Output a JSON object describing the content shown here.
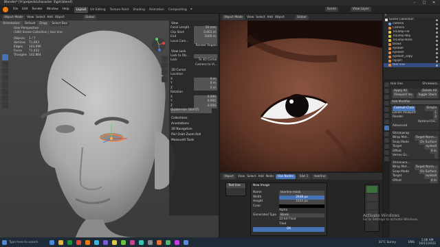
{
  "title_bar": {
    "title": "Blender* [A:\\projects\\character 3\\girl.blend]",
    "minimize": "–",
    "maximize": "□",
    "close": "✕"
  },
  "menu": [
    "File",
    "Edit",
    "Render",
    "Window",
    "Help"
  ],
  "workspaces": [
    "Layout",
    "UV Editing",
    "Texture Paint",
    "Shading",
    "Animation",
    "Compositing"
  ],
  "workspace_active": "Layout",
  "scene": {
    "label": "Scene",
    "view_layer": "View Layer"
  },
  "viewport": {
    "mode": "Object Mode",
    "menus": [
      "View",
      "Select",
      "Add",
      "Object"
    ],
    "orientation_label": "Orientation:",
    "orientation": "Default",
    "drag_label": "Drag:",
    "drag": "Select Box",
    "transform": "Global",
    "overlay": {
      "title": "User Perspective",
      "collection": "(180) Scene Collection | tear line",
      "stats": [
        {
          "k": "Objects",
          "v": "1 / 7"
        },
        {
          "k": "Vertices",
          "v": "71,663"
        },
        {
          "k": "Edges",
          "v": "143,096"
        },
        {
          "k": "Faces",
          "v": "71,433"
        },
        {
          "k": "Triangles",
          "v": "142,864"
        }
      ]
    }
  },
  "npanel": {
    "view_header": "View",
    "focal_length": {
      "label": "Focal Length",
      "value": "50 mm"
    },
    "clip_start": {
      "label": "Clip Start",
      "value": "0.001 m"
    },
    "clip_end": {
      "label": "End",
      "value": "1000 m"
    },
    "local_camera": "Local Cam...",
    "render_region": "Render Region",
    "view_lock": "View Lock",
    "lock_to_obj": "Lock to Ob...",
    "lock": "Lock",
    "to_3d_cursor": "To 3D Cursor",
    "camera_to_view": "Camera to Vi...",
    "cursor_header": "3D Cursor",
    "location": "Location",
    "loc": [
      {
        "k": "X",
        "v": "0 m"
      },
      {
        "k": "Y",
        "v": "0 m"
      },
      {
        "k": "Z",
        "v": "0 m"
      }
    ],
    "rotation": "Rotation",
    "rot": [
      {
        "k": "X",
        "v": "0.000"
      },
      {
        "k": "Y",
        "v": "0.000"
      },
      {
        "k": "Z",
        "v": "0.000"
      }
    ],
    "rotation_mode": "Quaternion (WXYZ)",
    "collections": "Collections",
    "annotations": "Annotations",
    "navigation": "3D Navigation",
    "pie": "Pie! Orbit Zoom Roll",
    "measureit": "MeasureIt Tools",
    "tabs": [
      "Item",
      "Tool",
      "View",
      "Edit",
      "Create"
    ]
  },
  "outliner": {
    "header": "Scene Collection",
    "rows": [
      {
        "name": "Scene Collection",
        "color": "#dddddd",
        "sel": false
      },
      {
        "name": "camera",
        "color": "#6699dd",
        "sel": false
      },
      {
        "name": "Camera",
        "color": "#e08a3c",
        "sel": false
      },
      {
        "name": "TriLamp-Fill",
        "color": "#e0c83c",
        "sel": false
      },
      {
        "name": "TriLamp-Key",
        "color": "#e0c83c",
        "sel": false
      },
      {
        "name": "TriLamp-Back",
        "color": "#e0c83c",
        "sel": false
      },
      {
        "name": "brows",
        "color": "#e08a3c",
        "sel": false
      },
      {
        "name": "eyeball",
        "color": "#e08a3c",
        "sel": false
      },
      {
        "name": "eyelash",
        "color": "#e08a3c",
        "sel": false
      },
      {
        "name": "eyelash_copy",
        "color": "#e08a3c",
        "sel": false
      },
      {
        "name": "rig.girl",
        "color": "#e08a3c",
        "sel": false
      },
      {
        "name": "tear line",
        "color": "#e08a3c",
        "sel": true
      }
    ]
  },
  "properties": {
    "object": "tear line",
    "modifier": "Shrinkwra...",
    "apply_all": "Apply All",
    "delete_all": "Delete All",
    "viewport_vis": "Viewport Vis",
    "toggle_stack": "Toggle Stack",
    "add_modifier": "Add Modifier",
    "subdiv_tabs": [
      "Catmull-Clark",
      "Simple"
    ],
    "levels_viewport": {
      "label": "Levels Viewport",
      "value": "1"
    },
    "render": {
      "label": "Render",
      "value": "2"
    },
    "optimal_display": "Optimal Dis...",
    "advanced": "Advanced",
    "mod1": "Shrinkwrap",
    "wrap_method_label": "Wrap Met...",
    "wrap_method_1": "Target Norm...",
    "snap_mode_label": "Snap Mode",
    "snap_mode_1": "On Surface",
    "target_label": "Target",
    "target_1": "eyeball",
    "offset_label": "Offset",
    "offset_1": "0 m",
    "vertex_group_label": "Vertex Gr...",
    "mod2": "Shrinkwra...",
    "wrap_method_2": "Target Norm...",
    "snap_mode_2": "On Surface",
    "target_2": "eyeball",
    "offset_2": "0 m"
  },
  "node_editor": {
    "type": "Object",
    "menus": [
      "View",
      "Select",
      "Add",
      "Node"
    ],
    "use_nodes": "Use Nodes",
    "slot": "Slot 1",
    "material": "tearline",
    "side_tabs": [
      "Node",
      "Tool",
      "View",
      "Options"
    ],
    "text_line_node": "Text line",
    "new_image_node": "New Image",
    "image": {
      "name": {
        "label": "Name",
        "value": "tearline mask"
      },
      "width": {
        "label": "Width",
        "value": "2048 px"
      },
      "height": {
        "label": "Height",
        "value": "1024 px"
      },
      "color": "Color",
      "alpha": "Alpha",
      "generated_type": {
        "label": "Generated Type",
        "value": "Blank"
      },
      "float": "32-bit Float",
      "tiled": "Tiled",
      "ok": "OK"
    }
  },
  "watermark": {
    "title": "Activate Windows",
    "text": "Go to Settings to activate Windows."
  },
  "taskbar": {
    "search": "Type here to search",
    "weather": "32°C  Sunny",
    "time": "1:06 AM",
    "date": "16/11/2022",
    "lang": "ENG",
    "app_colors": [
      "#4c8bd6",
      "#e8b33c",
      "#1e8f3f",
      "#dd4b39",
      "#e87d0d",
      "#3bb3e0",
      "#7c5cd6",
      "#e0c83c",
      "#6ac33a",
      "#d63c8a",
      "#3cc4b4",
      "#8a8a8a",
      "#e8743c",
      "#4cb86a",
      "#c43ce0",
      "#5a8ae0"
    ]
  }
}
